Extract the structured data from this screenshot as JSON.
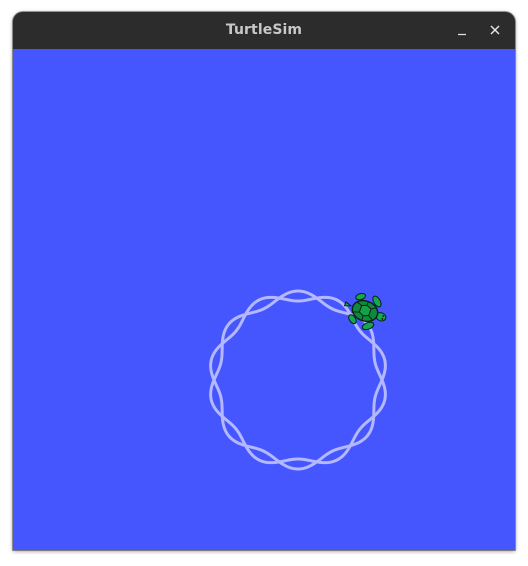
{
  "window": {
    "title": "TurtleSim",
    "buttons": [
      {
        "name": "minimize",
        "icon": "minimize-icon"
      },
      {
        "name": "close",
        "icon": "close-icon"
      }
    ]
  },
  "colors": {
    "titlebar": "#2c2c2c",
    "title_text": "#c8c8c8",
    "background": "#4556ff",
    "pen": "#b3b8ff",
    "turtle_shell": "#0d8a3e",
    "turtle_limbs": "#14a84f",
    "turtle_outline": "#0b1f12"
  },
  "simulation": {
    "background_rgb": [
      69,
      86,
      255
    ],
    "turtles": [
      {
        "name": "turtle1",
        "icon": "turtle-icon",
        "heading_deg": 20
      }
    ],
    "trail": {
      "shape": "wavy-circle",
      "loops": 2,
      "wobbles_per_loop": 7
    }
  }
}
